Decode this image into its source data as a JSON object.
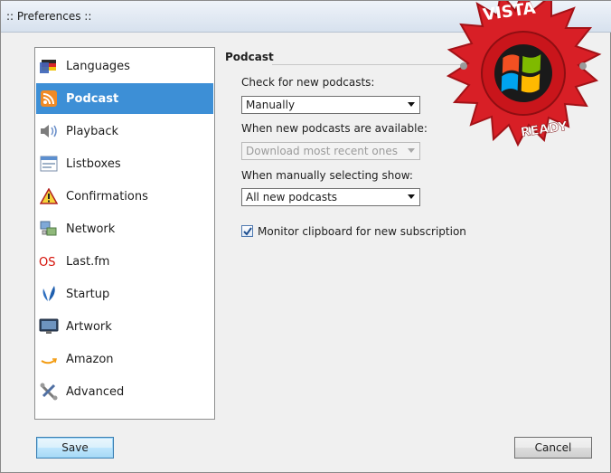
{
  "window": {
    "title": ":: Preferences ::"
  },
  "nav": {
    "items": [
      {
        "label": "Languages",
        "icon": "flag-icon",
        "selected": false
      },
      {
        "label": "Podcast",
        "icon": "rss-icon",
        "selected": true
      },
      {
        "label": "Playback",
        "icon": "speaker-icon",
        "selected": false
      },
      {
        "label": "Listboxes",
        "icon": "list-icon",
        "selected": false
      },
      {
        "label": "Confirmations",
        "icon": "warning-icon",
        "selected": false
      },
      {
        "label": "Network",
        "icon": "network-icon",
        "selected": false
      },
      {
        "label": "Last.fm",
        "icon": "lastfm-icon",
        "selected": false
      },
      {
        "label": "Startup",
        "icon": "startup-icon",
        "selected": false
      },
      {
        "label": "Artwork",
        "icon": "monitor-icon",
        "selected": false
      },
      {
        "label": "Amazon",
        "icon": "amazon-icon",
        "selected": false
      },
      {
        "label": "Advanced",
        "icon": "tools-icon",
        "selected": false
      }
    ]
  },
  "podcast": {
    "section_title": "Podcast",
    "check_label": "Check for new podcasts:",
    "check_value": "Manually",
    "available_label": "When new podcasts are available:",
    "available_value": "Download most recent ones",
    "manual_label": "When manually selecting show:",
    "manual_value": "All new podcasts",
    "monitor_label": "Monitor clipboard for new subscription",
    "monitor_checked": true
  },
  "buttons": {
    "save": "Save",
    "cancel": "Cancel"
  },
  "badge": {
    "top_text": "VISTA",
    "bottom_text": "READY"
  }
}
